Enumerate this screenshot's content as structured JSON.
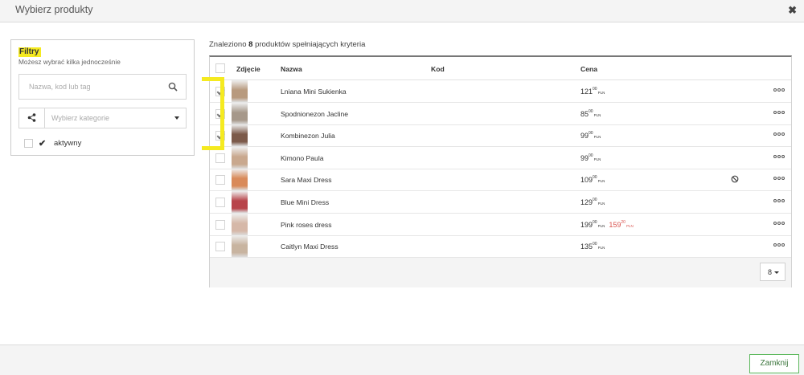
{
  "modal": {
    "title": "Wybierz produkty",
    "close_label": "Zamknij",
    "close_glyph": "✖"
  },
  "filters": {
    "title": "Filtry",
    "subtitle": "Możesz wybrać kilka jednocześnie",
    "search_placeholder": "Nazwa, kod lub tag",
    "category_placeholder": "Wybierz kategorie",
    "active_label": "aktywny",
    "highlight_color": "#f5ea20"
  },
  "results": {
    "found_prefix": "Znaleziono",
    "found_count": "8",
    "found_suffix": "produktów spełniających kryteria",
    "columns": {
      "photo": "Zdjęcie",
      "name": "Nazwa",
      "code": "Kod",
      "price": "Cena"
    },
    "per_page": "8",
    "currency": "PLN",
    "rows": [
      {
        "name": "Lniana Mini Sukienka",
        "price_main": "121",
        "price_cents": "00",
        "promo_main": "",
        "promo_cents": "",
        "checked": true,
        "inactive": false,
        "thumb_color": "#b89a7e"
      },
      {
        "name": "Spodnionezon Jacline",
        "price_main": "85",
        "price_cents": "00",
        "promo_main": "",
        "promo_cents": "",
        "checked": true,
        "inactive": false,
        "thumb_color": "#a6988a"
      },
      {
        "name": "Kombinezon Julia",
        "price_main": "99",
        "price_cents": "00",
        "promo_main": "",
        "promo_cents": "",
        "checked": true,
        "inactive": false,
        "thumb_color": "#7c5a4a"
      },
      {
        "name": "Kimono Paula",
        "price_main": "99",
        "price_cents": "00",
        "promo_main": "",
        "promo_cents": "",
        "checked": false,
        "inactive": false,
        "thumb_color": "#c9a88e"
      },
      {
        "name": "Sara Maxi Dress",
        "price_main": "109",
        "price_cents": "00",
        "promo_main": "",
        "promo_cents": "",
        "checked": false,
        "inactive": true,
        "thumb_color": "#d98a5a"
      },
      {
        "name": "Blue Mini Dress",
        "price_main": "129",
        "price_cents": "00",
        "promo_main": "",
        "promo_cents": "",
        "checked": false,
        "inactive": false,
        "thumb_color": "#b8444a"
      },
      {
        "name": "Pink roses dress",
        "price_main": "199",
        "price_cents": "00",
        "promo_main": "159",
        "promo_cents": "20",
        "checked": false,
        "inactive": false,
        "thumb_color": "#d6b8a8"
      },
      {
        "name": "Caitlyn Maxi Dress",
        "price_main": "135",
        "price_cents": "00",
        "promo_main": "",
        "promo_cents": "",
        "checked": false,
        "inactive": false,
        "thumb_color": "#c8b4a0"
      }
    ]
  }
}
